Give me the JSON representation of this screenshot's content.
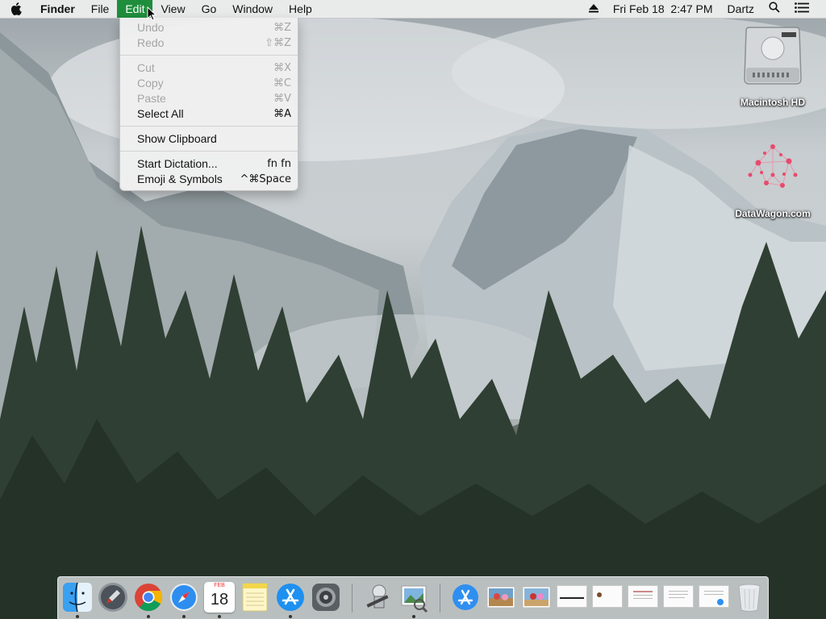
{
  "menubar": {
    "app_name": "Finder",
    "menus": [
      "File",
      "Edit",
      "View",
      "Go",
      "Window",
      "Help"
    ],
    "active_menu": "Edit",
    "clock": "Fri Feb 18  2:47 PM",
    "user": "Dartz",
    "icons": [
      "apple-icon",
      "eject-icon",
      "spotlight-icon",
      "notification-list-icon"
    ]
  },
  "edit_menu": {
    "items": [
      {
        "label": "Undo",
        "shortcut": "⌘Z",
        "enabled": false
      },
      {
        "label": "Redo",
        "shortcut": "⇧⌘Z",
        "enabled": false
      },
      {
        "label": "Cut",
        "shortcut": "⌘X",
        "enabled": false
      },
      {
        "label": "Copy",
        "shortcut": "⌘C",
        "enabled": false
      },
      {
        "label": "Paste",
        "shortcut": "⌘V",
        "enabled": false
      },
      {
        "label": "Select All",
        "shortcut": "⌘A",
        "enabled": true
      },
      {
        "label": "Show Clipboard",
        "shortcut": "",
        "enabled": true
      },
      {
        "label": "Start Dictation...",
        "shortcut": "fn fn",
        "enabled": true
      },
      {
        "label": "Emoji & Symbols",
        "shortcut": "^⌘Space",
        "enabled": true
      }
    ]
  },
  "desktop": {
    "icons": [
      {
        "label": "Macintosh HD",
        "icon": "hard-drive-icon"
      },
      {
        "label": "DataWagon.com",
        "icon": "network-graphic-icon"
      }
    ]
  },
  "dock": {
    "calendar_month": "FEB",
    "calendar_day": "18",
    "apps": [
      "finder-icon",
      "launchpad-icon",
      "chrome-icon",
      "safari-icon",
      "calendar-icon",
      "notes-icon",
      "app-store-icon",
      "system-preferences-icon",
      "automator-icon",
      "preview-icon"
    ],
    "stack_items": [
      "app-store-folder-icon",
      "photo-thumbnail-icon",
      "photo-thumbnail-icon",
      "document-thumbnail-icon",
      "document-thumbnail-icon",
      "document-thumbnail-icon",
      "document-thumbnail-icon",
      "document-thumbnail-icon",
      "trash-icon"
    ]
  },
  "colors": {
    "menu_highlight": "#1f8e3c",
    "menubar_bg": "#ececec"
  }
}
